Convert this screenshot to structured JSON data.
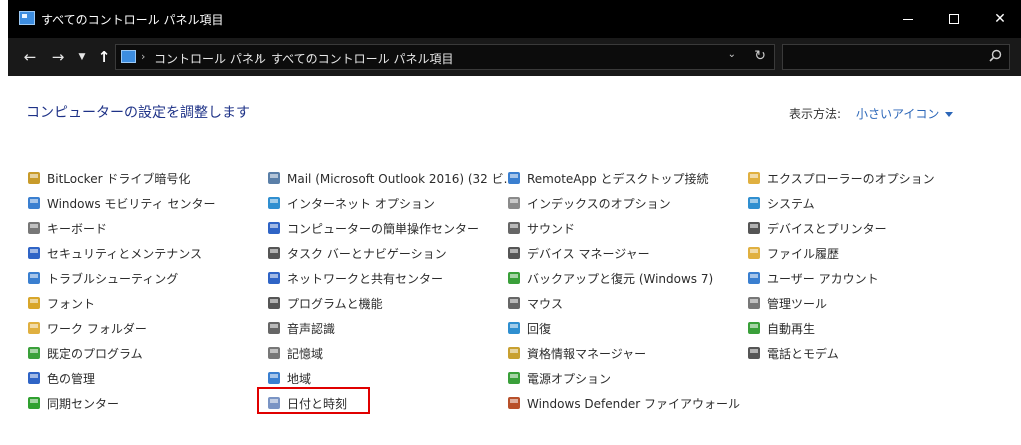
{
  "window": {
    "title": "すべてのコントロール パネル項目"
  },
  "address": {
    "crumbs": [
      "コントロール パネル",
      "すべてのコントロール パネル項目"
    ]
  },
  "search": {
    "placeholder": ""
  },
  "content": {
    "heading": "コンピューターの設定を調整します",
    "view_by_label": "表示方法:",
    "view_by_value": "小さいアイコン"
  },
  "items": [
    {
      "label": "BitLocker ドライブ暗号化",
      "icon": "bitlocker-icon",
      "color": "#c89b2a"
    },
    {
      "label": "Windows モビリティ センター",
      "icon": "mobility-center-icon",
      "color": "#3a7fd0"
    },
    {
      "label": "キーボード",
      "icon": "keyboard-icon",
      "color": "#777777"
    },
    {
      "label": "セキュリティとメンテナンス",
      "icon": "flag-icon",
      "color": "#2f64c6"
    },
    {
      "label": "トラブルシューティング",
      "icon": "troubleshooting-icon",
      "color": "#3a7fd0"
    },
    {
      "label": "フォント",
      "icon": "font-icon",
      "color": "#d8a62a"
    },
    {
      "label": "ワーク フォルダー",
      "icon": "work-folders-icon",
      "color": "#e0b040"
    },
    {
      "label": "既定のプログラム",
      "icon": "default-programs-icon",
      "color": "#3aa03a"
    },
    {
      "label": "色の管理",
      "icon": "color-management-icon",
      "color": "#2f64c6"
    },
    {
      "label": "同期センター",
      "icon": "sync-center-icon",
      "color": "#2fa02f"
    },
    {
      "label": "Mail (Microsoft Outlook 2016) (32 ビ...",
      "icon": "mail-icon",
      "color": "#5a7fa8"
    },
    {
      "label": "インターネット オプション",
      "icon": "internet-options-icon",
      "color": "#2f8fd0"
    },
    {
      "label": "コンピューターの簡単操作センター",
      "icon": "ease-of-access-icon",
      "color": "#2f64c6"
    },
    {
      "label": "タスク バーとナビゲーション",
      "icon": "taskbar-icon",
      "color": "#555555"
    },
    {
      "label": "ネットワークと共有センター",
      "icon": "network-icon",
      "color": "#2f64c6"
    },
    {
      "label": "プログラムと機能",
      "icon": "programs-features-icon",
      "color": "#555555"
    },
    {
      "label": "音声認識",
      "icon": "microphone-icon",
      "color": "#666666"
    },
    {
      "label": "記憶域",
      "icon": "storage-icon",
      "color": "#777777"
    },
    {
      "label": "地域",
      "icon": "region-icon",
      "color": "#3a7fd0"
    },
    {
      "label": "日付と時刻",
      "icon": "clock-icon",
      "color": "#7a94c4"
    },
    {
      "label": "RemoteApp とデスクトップ接続",
      "icon": "remoteapp-icon",
      "color": "#3a7fd0"
    },
    {
      "label": "インデックスのオプション",
      "icon": "indexing-icon",
      "color": "#8a8a8a"
    },
    {
      "label": "サウンド",
      "icon": "speaker-icon",
      "color": "#666666"
    },
    {
      "label": "デバイス マネージャー",
      "icon": "device-manager-icon",
      "color": "#555555"
    },
    {
      "label": "バックアップと復元 (Windows 7)",
      "icon": "backup-icon",
      "color": "#3aa03a"
    },
    {
      "label": "マウス",
      "icon": "mouse-icon",
      "color": "#666666"
    },
    {
      "label": "回復",
      "icon": "recovery-icon",
      "color": "#2f8fd0"
    },
    {
      "label": "資格情報マネージャー",
      "icon": "credential-icon",
      "color": "#c8a030"
    },
    {
      "label": "電源オプション",
      "icon": "power-icon",
      "color": "#3aa03a"
    },
    {
      "label": "Windows Defender ファイアウォール",
      "icon": "firewall-icon",
      "color": "#b8502a"
    },
    {
      "label": "エクスプローラーのオプション",
      "icon": "explorer-options-icon",
      "color": "#e0b040"
    },
    {
      "label": "システム",
      "icon": "system-icon",
      "color": "#2f8fd0"
    },
    {
      "label": "デバイスとプリンター",
      "icon": "printer-icon",
      "color": "#555555"
    },
    {
      "label": "ファイル履歴",
      "icon": "file-history-icon",
      "color": "#e0b040"
    },
    {
      "label": "ユーザー アカウント",
      "icon": "user-accounts-icon",
      "color": "#3a7fd0"
    },
    {
      "label": "管理ツール",
      "icon": "admin-tools-icon",
      "color": "#777777"
    },
    {
      "label": "自動再生",
      "icon": "autoplay-icon",
      "color": "#3aa03a"
    },
    {
      "label": "電話とモデム",
      "icon": "phone-modem-icon",
      "color": "#555555"
    }
  ]
}
